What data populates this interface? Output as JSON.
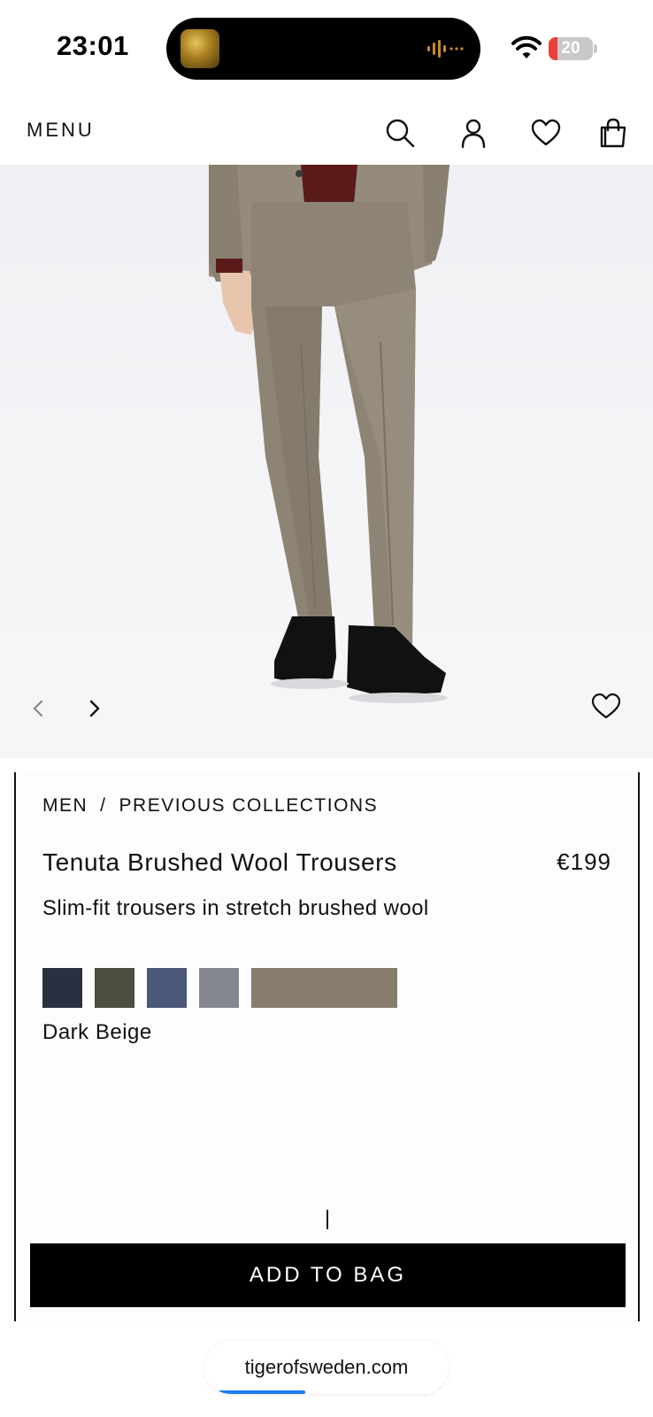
{
  "status_bar": {
    "time": "23:01",
    "battery_level": "20",
    "battery_fraction": 0.2,
    "battery_color": "#e8413c",
    "icons": [
      "music-thumbnail-icon",
      "audio-wave-icon",
      "wifi-icon",
      "battery-icon"
    ]
  },
  "header": {
    "menu_label": "MENU",
    "icons": [
      "search-icon",
      "account-icon",
      "wishlist-heart-icon",
      "shopping-bag-icon"
    ]
  },
  "gallery": {
    "prev_icon": "chevron-left-icon",
    "next_icon": "chevron-right-icon",
    "favorite_icon": "heart-icon"
  },
  "product": {
    "breadcrumb": {
      "level1": "MEN",
      "separator": "/",
      "level2": "PREVIOUS COLLECTIONS"
    },
    "name": "Tenuta Brushed Wool Trousers",
    "price": "€199",
    "description": "Slim-fit trousers in stretch brushed wool",
    "swatches": [
      {
        "color": "#2a3040"
      },
      {
        "color": "#4a4f3e"
      },
      {
        "color": "#4c5878"
      },
      {
        "color": "#84878d"
      },
      {
        "color": "#877d6d"
      }
    ],
    "selected_color": "Dark Beige",
    "add_to_bag_label": "ADD TO BAG"
  },
  "browser": {
    "url": "tigerofsweden.com",
    "load_progress": 0.4,
    "progress_color": "#1a7cf0"
  }
}
